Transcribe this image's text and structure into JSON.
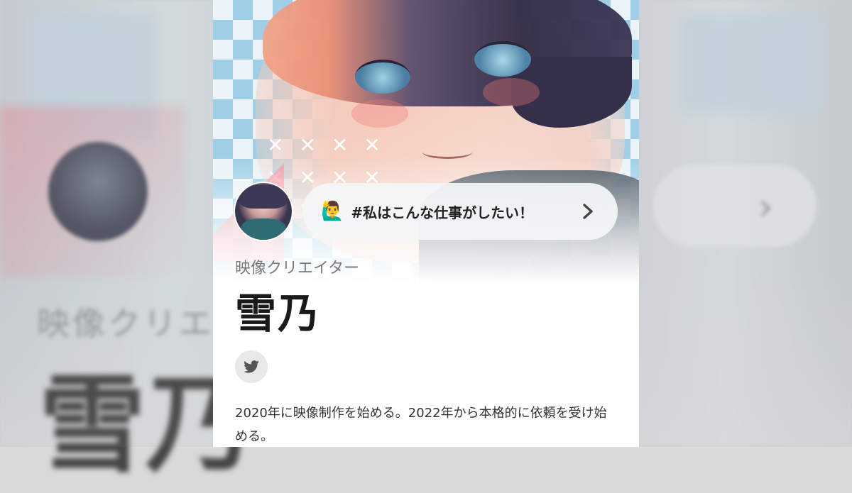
{
  "profile": {
    "role": "映像クリエイター",
    "name": "雪乃",
    "wish_label": "#私はこんな仕事がしたい！",
    "bio": "2020年に映像制作を始める。2022年から本格的に依頼を受け始める。"
  },
  "icons": {
    "wish_emoji": "🙋‍♂️",
    "chevron": "›",
    "social": "twitter-icon"
  },
  "colors": {
    "accent_pink": "#f496a0",
    "checker_blue": "#9fcfe6",
    "twitter_bg": "#e8e8e8"
  }
}
